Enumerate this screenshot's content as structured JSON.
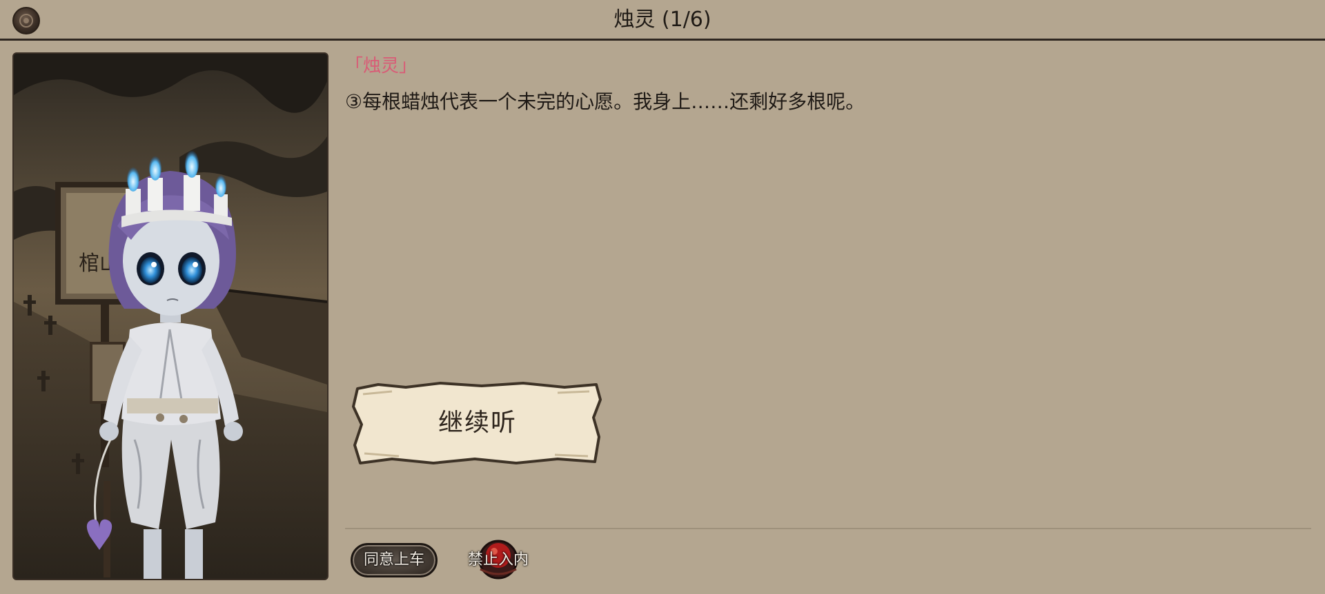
{
  "header": {
    "title": "烛灵 (1/6)",
    "back_icon": "back-medallion-icon"
  },
  "dialogue": {
    "speaker": "「烛灵」",
    "text": "③每根蜡烛代表一个未完的心愿。我身上……还剩好多根呢。"
  },
  "portrait": {
    "sign_text": "棺山"
  },
  "continue_button": {
    "label": "继续听"
  },
  "actions": {
    "agree_label": "同意上车",
    "deny_label": "禁止入内"
  },
  "colors": {
    "background": "#b4a690",
    "speaker_name": "#d95b76",
    "parchment": "#f1e6cf",
    "deny_red": "#b01c1c"
  }
}
